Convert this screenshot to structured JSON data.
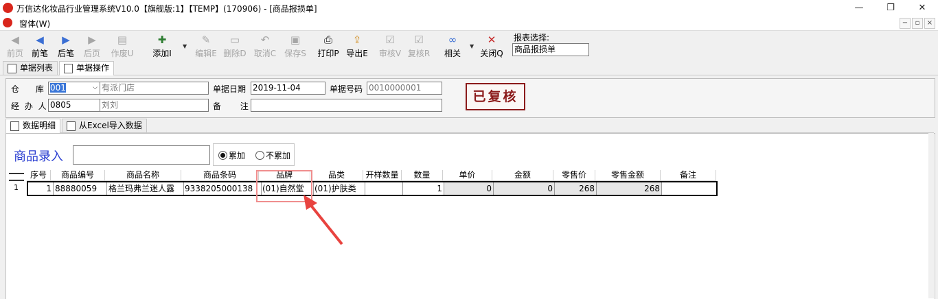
{
  "window": {
    "title": "万信达化妆品行业管理系统V10.0【旗舰版:1】【TEMP】(170906) - [商品报损单]",
    "menu": "窗体(W)",
    "controls": {
      "minimize": "—",
      "maximize": "❐",
      "close": "✕"
    },
    "mdi_controls": {
      "minimize": "−",
      "restore": "▫",
      "close": "×"
    }
  },
  "toolbar": {
    "items": [
      {
        "label": "前页",
        "icon": "first-page-icon",
        "glyph": "◀",
        "enabled": false
      },
      {
        "label": "前笔",
        "icon": "prev-record-icon",
        "glyph": "◀",
        "enabled": true
      },
      {
        "label": "后笔",
        "icon": "next-record-icon",
        "glyph": "▶",
        "enabled": true
      },
      {
        "label": "后页",
        "icon": "last-page-icon",
        "glyph": "▶",
        "enabled": false
      },
      {
        "label": "作废U",
        "icon": "void-icon",
        "glyph": "▤",
        "enabled": false
      },
      {
        "label": "添加I",
        "icon": "add-icon",
        "glyph": "✚",
        "enabled": true
      },
      {
        "label": "编辑E",
        "icon": "edit-icon",
        "glyph": "✎",
        "enabled": false
      },
      {
        "label": "删除D",
        "icon": "delete-icon",
        "glyph": "▭",
        "enabled": false
      },
      {
        "label": "取消C",
        "icon": "cancel-icon",
        "glyph": "↶",
        "enabled": false
      },
      {
        "label": "保存S",
        "icon": "save-icon",
        "glyph": "▣",
        "enabled": false
      },
      {
        "label": "打印P",
        "icon": "print-icon",
        "glyph": "⎙",
        "enabled": true
      },
      {
        "label": "导出E",
        "icon": "export-icon",
        "glyph": "⇪",
        "enabled": true
      },
      {
        "label": "审核V",
        "icon": "audit-icon",
        "glyph": "☑",
        "enabled": false
      },
      {
        "label": "复核R",
        "icon": "recheck-icon",
        "glyph": "☑",
        "enabled": false
      },
      {
        "label": "相关",
        "icon": "link-icon",
        "glyph": "∞",
        "enabled": true
      },
      {
        "label": "关闭Q",
        "icon": "close-icon",
        "glyph": "✕",
        "enabled": true
      }
    ],
    "report_select_label": "报表选择:",
    "report_select_value": "商品报损单"
  },
  "main_tabs": [
    "单据列表",
    "单据操作"
  ],
  "header": {
    "warehouse_label": "仓 库",
    "warehouse_code": "001",
    "warehouse_name": "有派门店",
    "date_label": "单据日期",
    "date_value": "2019-11-04",
    "doc_no_label": "单据号码",
    "doc_no_value": "0010000001",
    "handler_label": "经 办 人",
    "handler_code": "0805",
    "handler_name": "刘刘",
    "remark_label": "备 注",
    "remark_value": "",
    "stamp": "已复核"
  },
  "sub_tabs": [
    "数据明细",
    "从Excel导入数据"
  ],
  "entry": {
    "label": "商品录入",
    "value": "",
    "radio_accumulate": "累加",
    "radio_no_accumulate": "不累加",
    "accumulate_selected": true
  },
  "grid": {
    "columns": [
      "序号",
      "商品编号",
      "商品名称",
      "商品条码",
      "品牌",
      "品类",
      "开样数量",
      "数量",
      "单价",
      "金额",
      "零售价",
      "零售金额",
      "备注"
    ],
    "rows": [
      {
        "row_no": "1",
        "cells": [
          "1",
          "88880059",
          "格兰玛弗兰迷人露",
          "9338205000138",
          "(01)自然堂",
          "(01)护肤类",
          "",
          "1",
          "0",
          "0",
          "268",
          "268",
          ""
        ]
      }
    ]
  },
  "colors": {
    "stamp": "#8b1a1a",
    "entry_label": "#2b3fd1",
    "highlight": "#f08e8e",
    "arrow": "#e8433f"
  }
}
